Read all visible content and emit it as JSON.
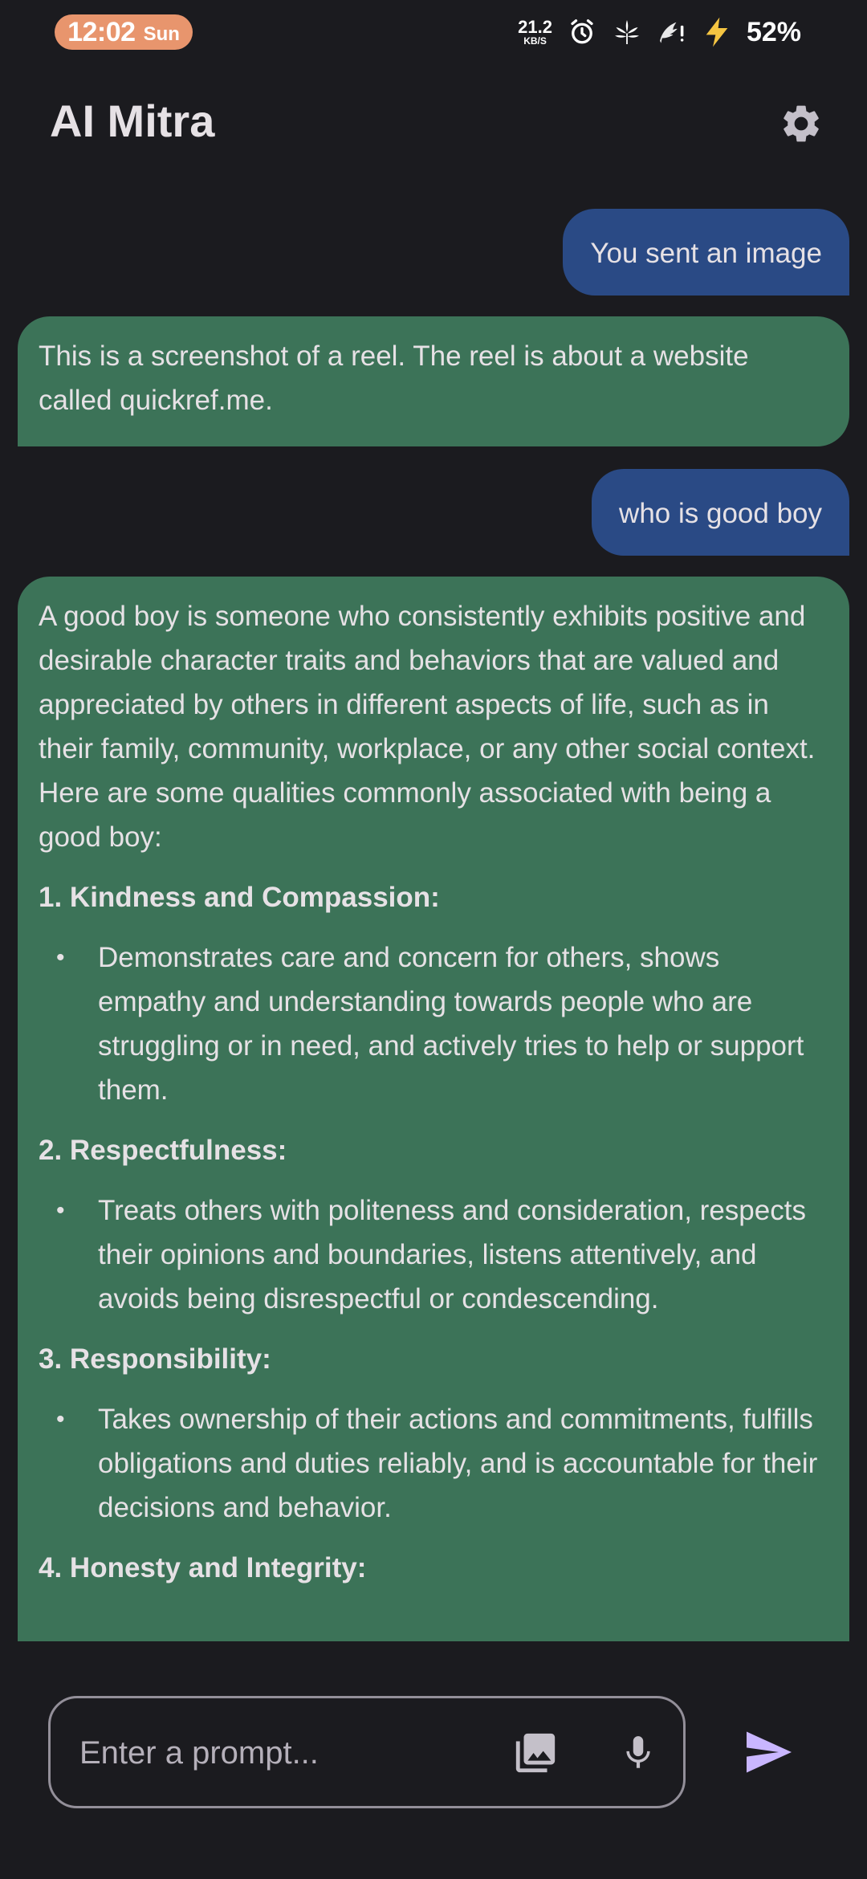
{
  "status_bar": {
    "time": "12:02",
    "day": "Sun",
    "net_speed_value": "21.2",
    "net_speed_unit": "KB/S",
    "battery": "52%",
    "icons": [
      "alarm-icon",
      "cannabis-icon",
      "feather-alert-icon",
      "charging-bolt-icon"
    ]
  },
  "app_bar": {
    "title": "AI Mitra",
    "settings_icon": "gear-icon"
  },
  "messages": [
    {
      "role": "user",
      "text": "You sent an image"
    },
    {
      "role": "ai",
      "text": "This is a screenshot of a reel. The reel is about a website called quickref.me."
    },
    {
      "role": "user",
      "text": "who is good boy"
    },
    {
      "role": "ai",
      "intro": "A good boy is someone who consistently exhibits positive and desirable character traits and behaviors that are valued and appreciated by others in different aspects of life, such as in their family, community, workplace, or any other social context. Here are some qualities commonly associated with being a good boy:",
      "sections": [
        {
          "heading": "1. Kindness and Compassion:",
          "bullet": "Demonstrates care and concern for others, shows empathy and understanding towards people who are struggling or in need, and actively tries to help or support them."
        },
        {
          "heading": "2. Respectfulness:",
          "bullet": "Treats others with politeness and consideration, respects their opinions and boundaries, listens attentively, and avoids being disrespectful or condescending."
        },
        {
          "heading": "3. Responsibility:",
          "bullet": "Takes ownership of their actions and commitments, fulfills obligations and duties reliably, and is accountable for their decisions and behavior."
        },
        {
          "heading": "4. Honesty and Integrity:",
          "bullet": ""
        }
      ]
    }
  ],
  "input": {
    "placeholder": "Enter a prompt...",
    "value": "",
    "image_icon": "image-gallery-icon",
    "mic_icon": "microphone-icon",
    "send_icon": "send-icon"
  },
  "colors": {
    "background": "#1b1b1f",
    "user_bubble": "#2a4a85",
    "ai_bubble": "#3c7358",
    "accent": "#c9b6ff",
    "time_pill": "#e8956d"
  }
}
